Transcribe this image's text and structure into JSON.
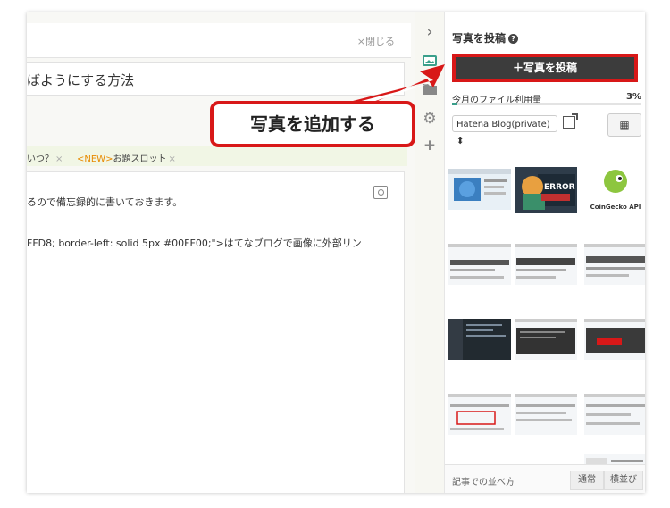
{
  "editor": {
    "close_label": "×閉じる",
    "title_fragment": "ばようにする方法",
    "tags": [
      {
        "prefix": "",
        "label": "いつ？",
        "remove": "×"
      },
      {
        "prefix": "<NEW>",
        "label": "お題スロット",
        "remove": "×"
      }
    ],
    "body_line1": "るので備忘録的に書いておきます。",
    "body_line2": "FFD8; border-left: solid 5px #00FF00;\">はてなブログで画像に外部リン"
  },
  "sidebar": {
    "title": "写真を投稿",
    "help_icon": "?",
    "post_button": "＋写真を投稿",
    "usage_label": "今月のファイル利用量",
    "usage_percent": "3%",
    "usage_fraction": 0.03,
    "blog_select": "Hatena Blog(private) ⬍",
    "grid_icon": "▦",
    "thumb_labels": {
      "error": "ERROR",
      "coingecko": "CoinGecko API"
    },
    "sort_label": "記事での並べ方",
    "sort_normal": "通常",
    "sort_horizontal": "横並び"
  },
  "icons": [
    "chevron-right-icon",
    "photo-icon",
    "folder-icon",
    "gear-icon",
    "plus-icon",
    "question-icon",
    "external-link-icon",
    "grid-icon",
    "preview-icon"
  ],
  "annotation": {
    "callout_text": "写真を追加する",
    "color": "#d81818"
  },
  "colors": {
    "accent": "#3a9f8b",
    "button_bg": "#3c3c3c",
    "highlight": "#d81818"
  }
}
